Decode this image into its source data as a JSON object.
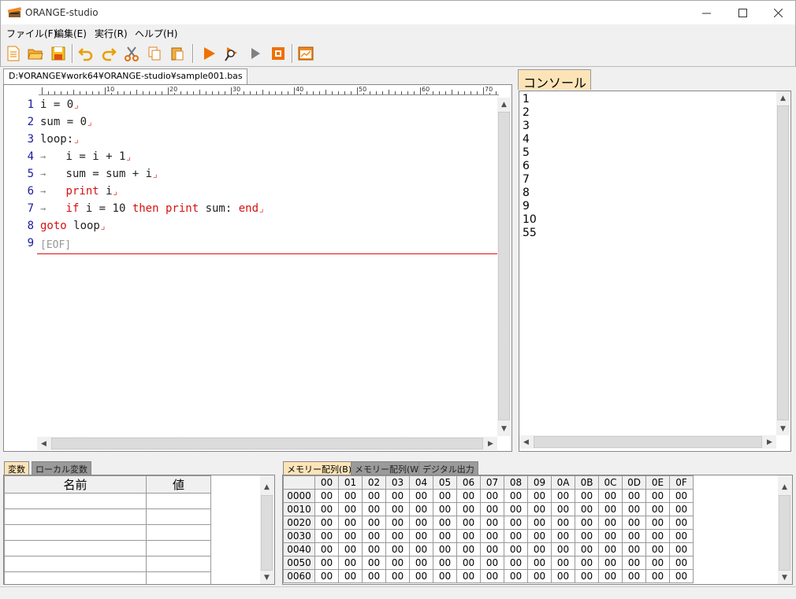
{
  "window": {
    "title": "ORANGE-studio"
  },
  "menu": {
    "items": [
      "ファイル(F)",
      "編集(E)",
      "実行(R)",
      "ヘルプ(H)"
    ]
  },
  "toolbar": {
    "buttons": [
      "new-file-icon",
      "open-folder-icon",
      "save-icon",
      "undo-icon",
      "redo-icon",
      "cut-icon",
      "copy-icon",
      "paste-icon",
      "run-icon",
      "debug-icon",
      "step-icon",
      "stop-icon",
      "graphics-window-icon"
    ]
  },
  "editor": {
    "tab_label": "D:¥ORANGE¥work64¥ORANGE-studio¥sample001.bas",
    "ruler_labels": [
      "10",
      "20",
      "30",
      "40",
      "50",
      "60",
      "70"
    ],
    "line_numbers": [
      "1",
      "2",
      "3",
      "4",
      "5",
      "6",
      "7",
      "8",
      "9"
    ],
    "eof_marker": "[EOF]",
    "eol_marker": "⌟",
    "tab_marker": "→"
  },
  "console": {
    "tab_label": "コンソール",
    "output": [
      "1",
      "2",
      "3",
      "4",
      "5",
      "6",
      "7",
      "8",
      "9",
      "10",
      "55"
    ]
  },
  "variables": {
    "tabs": [
      "変数",
      "ローカル変数"
    ],
    "columns": [
      "名前",
      "値"
    ]
  },
  "memory": {
    "tabs": [
      "メモリー配列(B)",
      "メモリー配列(W)",
      "デジタル出力"
    ],
    "columns": [
      "00",
      "01",
      "02",
      "03",
      "04",
      "05",
      "06",
      "07",
      "08",
      "09",
      "0A",
      "0B",
      "0C",
      "0D",
      "0E",
      "0F"
    ],
    "rows": [
      "0000",
      "0010",
      "0020",
      "0030",
      "0040",
      "0050",
      "0060"
    ],
    "cell_value": "00"
  },
  "colors": {
    "keyword": "#d81010",
    "line_number": "#1a1aa0",
    "active_tab": "#fde4b8"
  }
}
